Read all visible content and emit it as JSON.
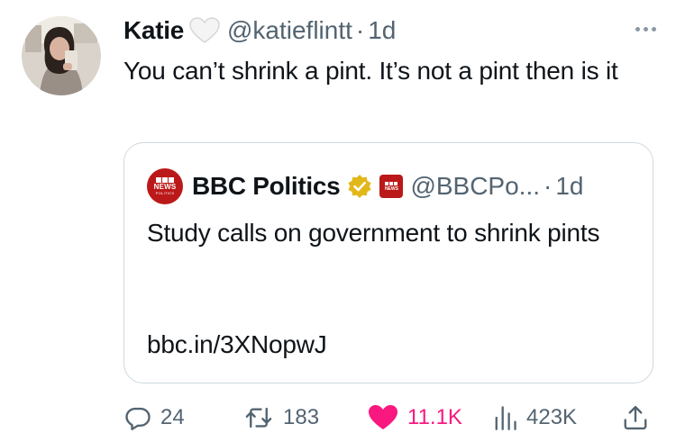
{
  "tweet": {
    "author": {
      "display_name": "Katie",
      "badge_icon": "white-heart-icon",
      "handle": "@katieflintt",
      "separator": "·",
      "time": "1d"
    },
    "text": "You can’t shrink a pint. It’s not a pint then is it",
    "more_icon": "more-horizontal-icon"
  },
  "quote": {
    "avatar_logo": {
      "word": "NEWS",
      "sub": "POLITICS"
    },
    "display_name": "BBC Politics",
    "verified_icon": "gold-verified-check-icon",
    "affiliate_logo_word": "NEWS",
    "handle": "@BBCPo...",
    "separator": "·",
    "time": "1d",
    "text": "Study calls on government to shrink pints",
    "link": "bbc.in/3XNopwJ"
  },
  "actions": {
    "reply": {
      "icon": "reply-bubble-icon",
      "count": "24"
    },
    "retweet": {
      "icon": "retweet-icon",
      "count": "183"
    },
    "like": {
      "icon": "heart-filled-icon",
      "count": "11.1K"
    },
    "views": {
      "icon": "bar-chart-icon",
      "count": "423K"
    },
    "share": {
      "icon": "share-upload-icon"
    }
  },
  "colors": {
    "text": "#0f1419",
    "secondary": "#536471",
    "border": "#cfd9de",
    "like": "#f91880",
    "bbc_red": "#bb1919",
    "verified_gold": "#e2b719"
  }
}
